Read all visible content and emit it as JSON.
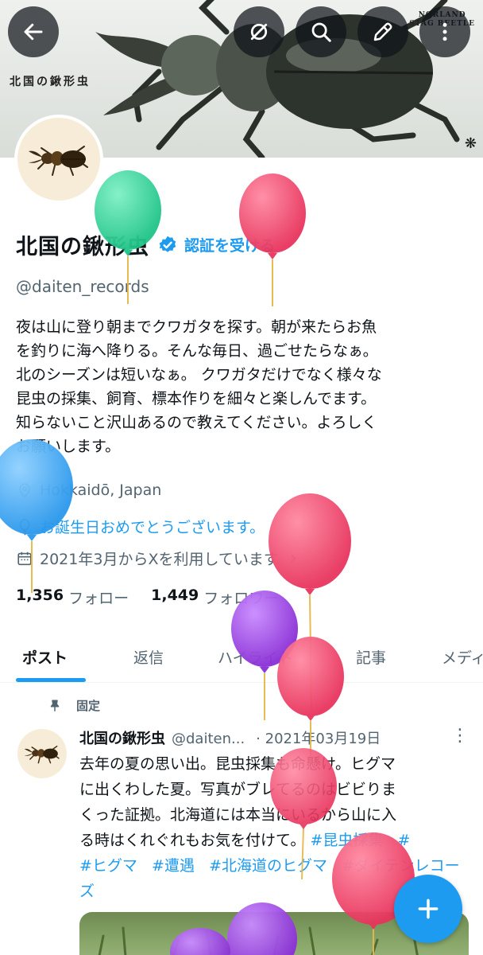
{
  "banner": {
    "title": "北国の鍬形虫",
    "brand_line1": "NORLAND",
    "brand_line2": "STAG BEETLE",
    "mark": "❋"
  },
  "topbar": {
    "back_icon": "arrow-left-icon",
    "grok_icon": "grok-icon",
    "search_icon": "search-icon",
    "edit_icon": "pencil-icon",
    "more_icon": "more-vertical-icon"
  },
  "profile": {
    "display_name": "北国の鍬形虫",
    "verify_label": "認証を受ける",
    "handle": "@daiten_records",
    "bio_lines": [
      "夜は山に登り朝までクワガタを探す。朝が来たらお魚",
      "を釣りに海へ降りる。そんな毎日、過ごせたらなぁ。",
      "北のシーズンは短いなぁ。 クワガタだけでなく様々な",
      "昆虫の採集、飼育、標本作りを細々と楽しんでます。",
      "知らないこと沢山あるので教えてください。よろしく",
      "お願いします。"
    ],
    "location": "Hokkaidō, Japan",
    "birthday": "お誕生日おめでとうございます。",
    "joined": "2021年3月からXを利用しています",
    "following_count": "1,356",
    "following_label": "フォロー",
    "followers_count": "1,449",
    "followers_label": "フォロワー"
  },
  "tabs": [
    "ポスト",
    "返信",
    "ハイライト",
    "記事",
    "メディア"
  ],
  "tweet": {
    "pinned_label": "固定",
    "name": "北国の鍬形虫",
    "handle": "@daiten...",
    "date": "· 2021年03月19日",
    "more": "⋮",
    "lines": [
      "去年の夏の思い出。昆虫採集も命懸け。ヒグマ",
      "に出くわした夏。写真がブレてるのはビビりま",
      "くった証拠。北海道には本当にいるから山に入",
      "る時はくれぐれもお気を付けて。"
    ],
    "hashtags": [
      "#昆虫採集",
      "#ヒグマ",
      "#遭遇",
      "#北海道のヒグマ",
      "#ダイテンレコーズ"
    ]
  },
  "colors": {
    "accent": "#1d9bf0",
    "text": "#0f1419",
    "muted": "#536471",
    "balloon_green": "#2fd59b",
    "balloon_red": "#f0466b",
    "balloon_blue": "#3aa7f2",
    "balloon_purple": "#9b3fe0"
  }
}
